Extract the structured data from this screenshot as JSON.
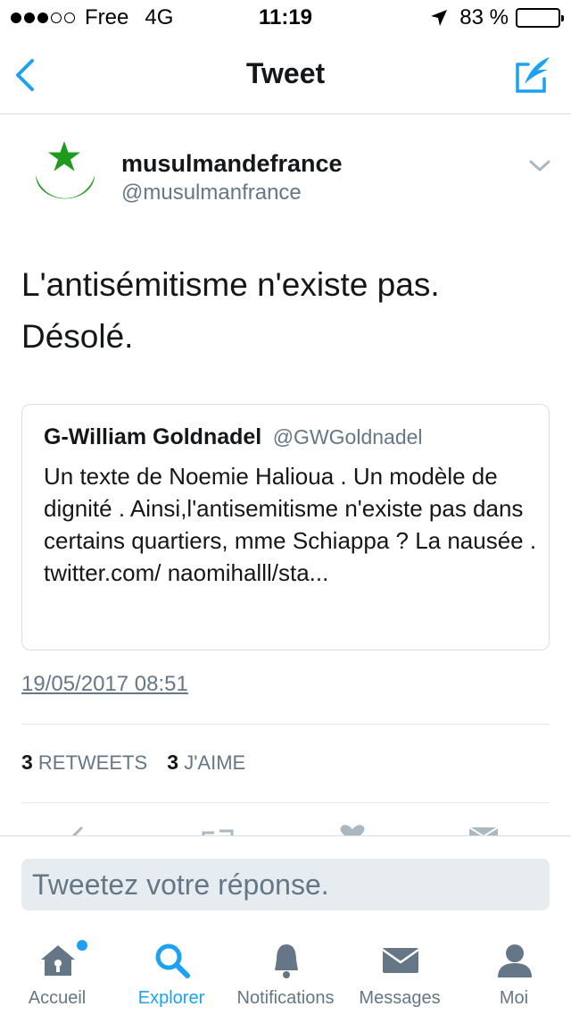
{
  "status_bar": {
    "carrier": "Free",
    "network": "4G",
    "time": "11:19",
    "battery": "83 %",
    "battery_level": 0.83
  },
  "nav": {
    "title": "Tweet",
    "back_icon": "chevron-left-icon",
    "compose_icon": "compose-quill-icon"
  },
  "tweet": {
    "author_name": "musulmandefrance",
    "author_handle": "@musulmanfrance",
    "text_line1": "L'antisémitisme n'existe pas.",
    "text_line2": "Désolé.",
    "quoted": {
      "name": "G-William Goldnadel",
      "handle": "@GWGoldnadel",
      "text": "Un texte de Noemie Halioua . Un modèle de dignité . Ainsi,l'antisemitisme n'existe pas dans certains quartiers, mme Schiappa ? La nausée . twitter.com/ naomihalll/sta..."
    },
    "timestamp": "19/05/2017 08:51",
    "retweets_count": "3",
    "retweets_label": "RETWEETS",
    "likes_count": "3",
    "likes_label": "J'AIME"
  },
  "reply": {
    "placeholder": "Tweetez votre réponse."
  },
  "tabs": [
    {
      "label": "Accueil",
      "icon": "home-icon",
      "active": false
    },
    {
      "label": "Explorer",
      "icon": "search-icon",
      "active": true
    },
    {
      "label": "Notifications",
      "icon": "bell-icon",
      "active": false
    },
    {
      "label": "Messages",
      "icon": "envelope-icon",
      "active": false
    },
    {
      "label": "Moi",
      "icon": "person-icon",
      "active": false
    }
  ],
  "colors": {
    "accent": "#1da1f2",
    "avatar_green": "#1f9a1f",
    "secondary_text": "#657786"
  }
}
